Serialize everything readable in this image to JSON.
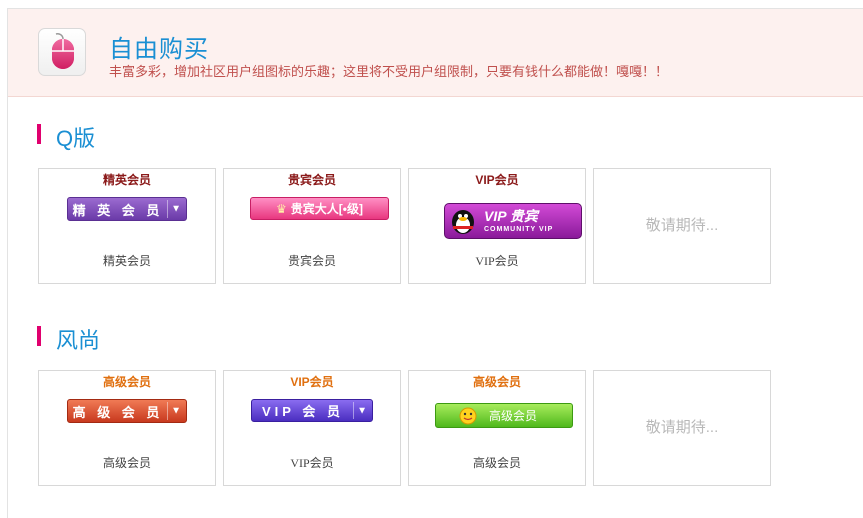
{
  "header": {
    "icon": "mouse-icon",
    "title": "自由购买",
    "description": "丰富多彩，增加社区用户组图标的乐趣；这里将不受用户组限制，只要有钱什么都能做！嘎嘎！！"
  },
  "sections": [
    {
      "title": "Q版",
      "cards": [
        {
          "title": "精英会员",
          "title_color": "#8b1a1a",
          "badge_text": "精 英 会 员",
          "badge_icon": "chevron-down-icon",
          "name": "精英会员"
        },
        {
          "title": "贵宾会员",
          "title_color": "#8b1a1a",
          "badge_text": "贵宾大人[•级]",
          "badge_icon": "crown-icon",
          "name": "贵宾会员"
        },
        {
          "title": "VIP会员",
          "title_color": "#8b1a1a",
          "badge_text": "VIP 贵宾",
          "badge_subtext": "COMMUNITY VIP",
          "badge_icon": "penguin-icon",
          "name": "VIP会员"
        },
        {
          "coming_soon": "敬请期待..."
        }
      ]
    },
    {
      "title": "风尚",
      "cards": [
        {
          "title": "高级会员",
          "title_color": "#e07010",
          "badge_text": "高 级 会 员",
          "badge_icon": "chevron-down-icon",
          "name": "高级会员"
        },
        {
          "title": "VIP会员",
          "title_color": "#e07010",
          "badge_text": "VIP 会 员",
          "badge_icon": "chevron-down-icon",
          "name": "VIP会员"
        },
        {
          "title": "高级会员",
          "title_color": "#e07010",
          "badge_text": "高级会员",
          "badge_icon": "smiley-icon",
          "name": "高级会员"
        },
        {
          "coming_soon": "敬请期待..."
        }
      ]
    }
  ],
  "colors": {
    "accent_blue": "#1a8fd3",
    "section_bar": "#e0006e",
    "header_bg": "#fdf1ef",
    "description_red": "#c0504d",
    "placeholder_gray": "#b8b8b8"
  }
}
